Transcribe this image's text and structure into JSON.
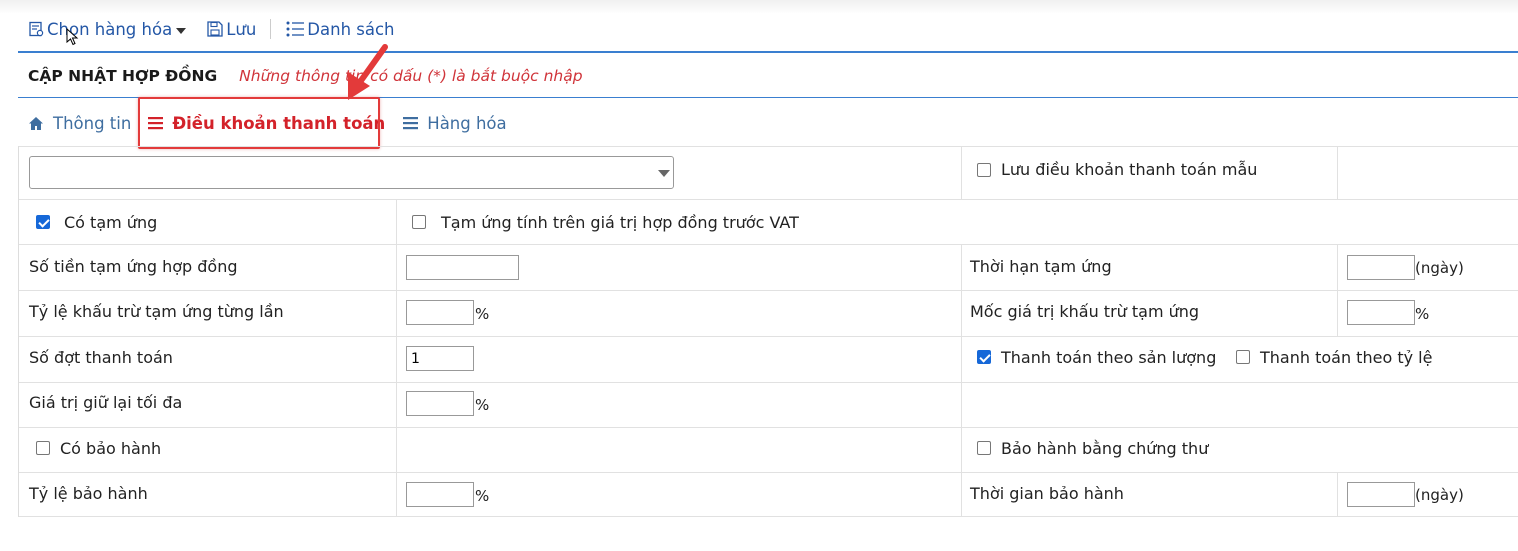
{
  "toolbar": {
    "choose_goods": "Chọn hàng hóa",
    "save": "Lưu",
    "list": "Danh sách"
  },
  "header": {
    "title": "CẬP NHẬT HỢP ĐỒNG",
    "required_note": "Những thông tin có dấu (*) là bắt buộc nhập"
  },
  "tabs": [
    {
      "label": "Thông tin",
      "icon": "home-icon"
    },
    {
      "label": "Điều khoản thanh toán",
      "icon": "list-icon",
      "active": true
    },
    {
      "label": "Hàng hóa",
      "icon": "list-icon"
    }
  ],
  "form": {
    "template_select_value": "",
    "save_template_label": "Lưu điều khoản thanh toán mẫu",
    "advance_label": "Có tạm ứng",
    "advance_checked": true,
    "advance_pre_vat_label": "Tạm ứng tính trên giá trị hợp đồng trước VAT",
    "advance_pre_vat_checked": false,
    "advance_amount_label": "Số tiền tạm ứng hợp đồng",
    "advance_amount_value": "",
    "advance_term_label": "Thời hạn tạm ứng",
    "advance_term_value": "",
    "days_unit": "(ngày)",
    "deduct_rate_label": "Tỷ lệ khấu trừ tạm ứng từng lần",
    "deduct_rate_value": "",
    "percent_unit": "%",
    "deduct_threshold_label": "Mốc giá trị khấu trừ tạm ứng",
    "deduct_threshold_value": "",
    "installments_label": "Số đợt thanh toán",
    "installments_value": "1",
    "pay_by_output_label": "Thanh toán theo sản lượng",
    "pay_by_output_checked": true,
    "pay_by_rate_label": "Thanh toán theo tỷ lệ",
    "pay_by_rate_checked": false,
    "max_retention_label": "Giá trị giữ lại tối đa",
    "max_retention_value": "",
    "warranty_label": "Có bảo hành",
    "warranty_checked": false,
    "warranty_certificate_label": "Bảo hành bằng chứng thư",
    "warranty_certificate_checked": false,
    "warranty_rate_label": "Tỷ lệ bảo hành",
    "warranty_rate_value": "",
    "warranty_period_label": "Thời gian bảo hành",
    "warranty_period_value": ""
  },
  "colors": {
    "link_blue": "#2457a6",
    "tab_blue": "#3f6ea0",
    "active_red": "#d3222a",
    "checkbox_blue": "#1668d8",
    "divider_blue": "#3a7fd0"
  }
}
